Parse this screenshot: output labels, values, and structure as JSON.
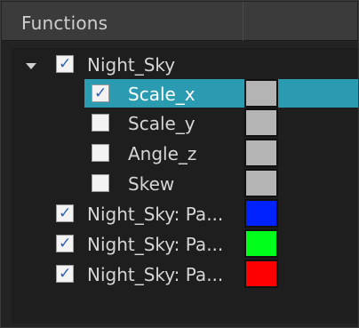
{
  "panel": {
    "title": "Functions"
  },
  "tree": {
    "root": {
      "label": "Night_Sky",
      "checked": true,
      "expanded": true
    },
    "children": [
      {
        "label": "Scale_x",
        "checked": true,
        "selected": true,
        "color": "#b4b4b4"
      },
      {
        "label": "Scale_y",
        "checked": false,
        "selected": false,
        "color": "#b4b4b4"
      },
      {
        "label": "Angle_z",
        "checked": false,
        "selected": false,
        "color": "#b4b4b4"
      },
      {
        "label": "Skew",
        "checked": false,
        "selected": false,
        "color": "#b4b4b4"
      }
    ],
    "siblings": [
      {
        "label": "Night_Sky: Pa...",
        "checked": true,
        "color": "#0022ff"
      },
      {
        "label": "Night_Sky: Pa...",
        "checked": true,
        "color": "#00ff1a"
      },
      {
        "label": "Night_Sky: Pa...",
        "checked": true,
        "color": "#ff0000"
      }
    ]
  },
  "colors": {
    "selection": "#2a9bb0",
    "header_bg": "#3b3b3b",
    "panel_bg": "#232323",
    "checkmark": "#2d5fb5"
  },
  "icons": {
    "expander": "chevron-down-icon",
    "check": "checkmark-icon"
  }
}
